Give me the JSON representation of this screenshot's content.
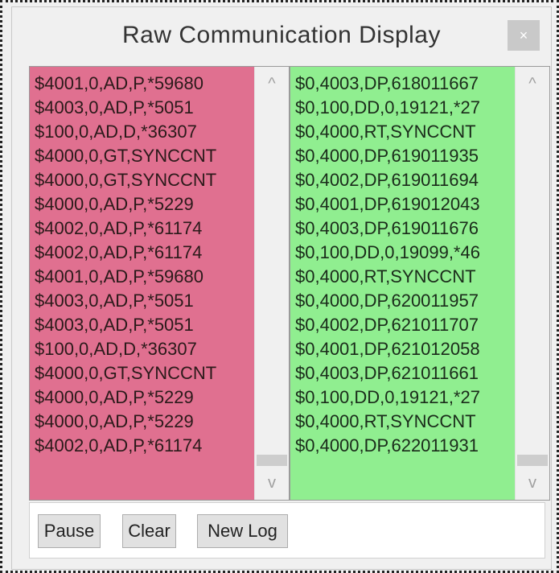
{
  "window": {
    "title": "Raw Communication Display",
    "close_label": "×"
  },
  "left_pane": {
    "lines": [
      "$4001,0,AD,P,*59680",
      "$4003,0,AD,P,*5051",
      "$100,0,AD,D,*36307",
      "$4000,0,GT,SYNCCNT",
      "$4000,0,GT,SYNCCNT",
      "$4000,0,AD,P,*5229",
      "$4002,0,AD,P,*61174",
      "$4002,0,AD,P,*61174",
      "$4001,0,AD,P,*59680",
      "$4003,0,AD,P,*5051",
      "$4003,0,AD,P,*5051",
      "$100,0,AD,D,*36307",
      "$4000,0,GT,SYNCCNT",
      "$4000,0,AD,P,*5229",
      "$4000,0,AD,P,*5229",
      "$4002,0,AD,P,*61174"
    ],
    "background": "#e07090"
  },
  "right_pane": {
    "lines": [
      "$0,4003,DP,618011667",
      "$0,100,DD,0,19121,*27",
      "$0,4000,RT,SYNCCNT",
      "$0,4000,DP,619011935",
      "$0,4002,DP,619011694",
      "$0,4001,DP,619012043",
      "$0,4003,DP,619011676",
      "$0,100,DD,0,19099,*46",
      "$0,4000,RT,SYNCCNT",
      "$0,4000,DP,620011957",
      "$0,4002,DP,621011707",
      "$0,4001,DP,621012058",
      "$0,4003,DP,621011661",
      "$0,100,DD,0,19121,*27",
      "$0,4000,RT,SYNCCNT",
      "$0,4000,DP,622011931"
    ],
    "background": "#90ee90"
  },
  "scrollbar": {
    "up_icon": "chevron-up-icon",
    "down_icon": "chevron-down-icon",
    "up_glyph": "^",
    "down_glyph": "v"
  },
  "buttons": {
    "pause_label": "Pause",
    "clear_label": "Clear",
    "new_log_label": "New Log"
  }
}
